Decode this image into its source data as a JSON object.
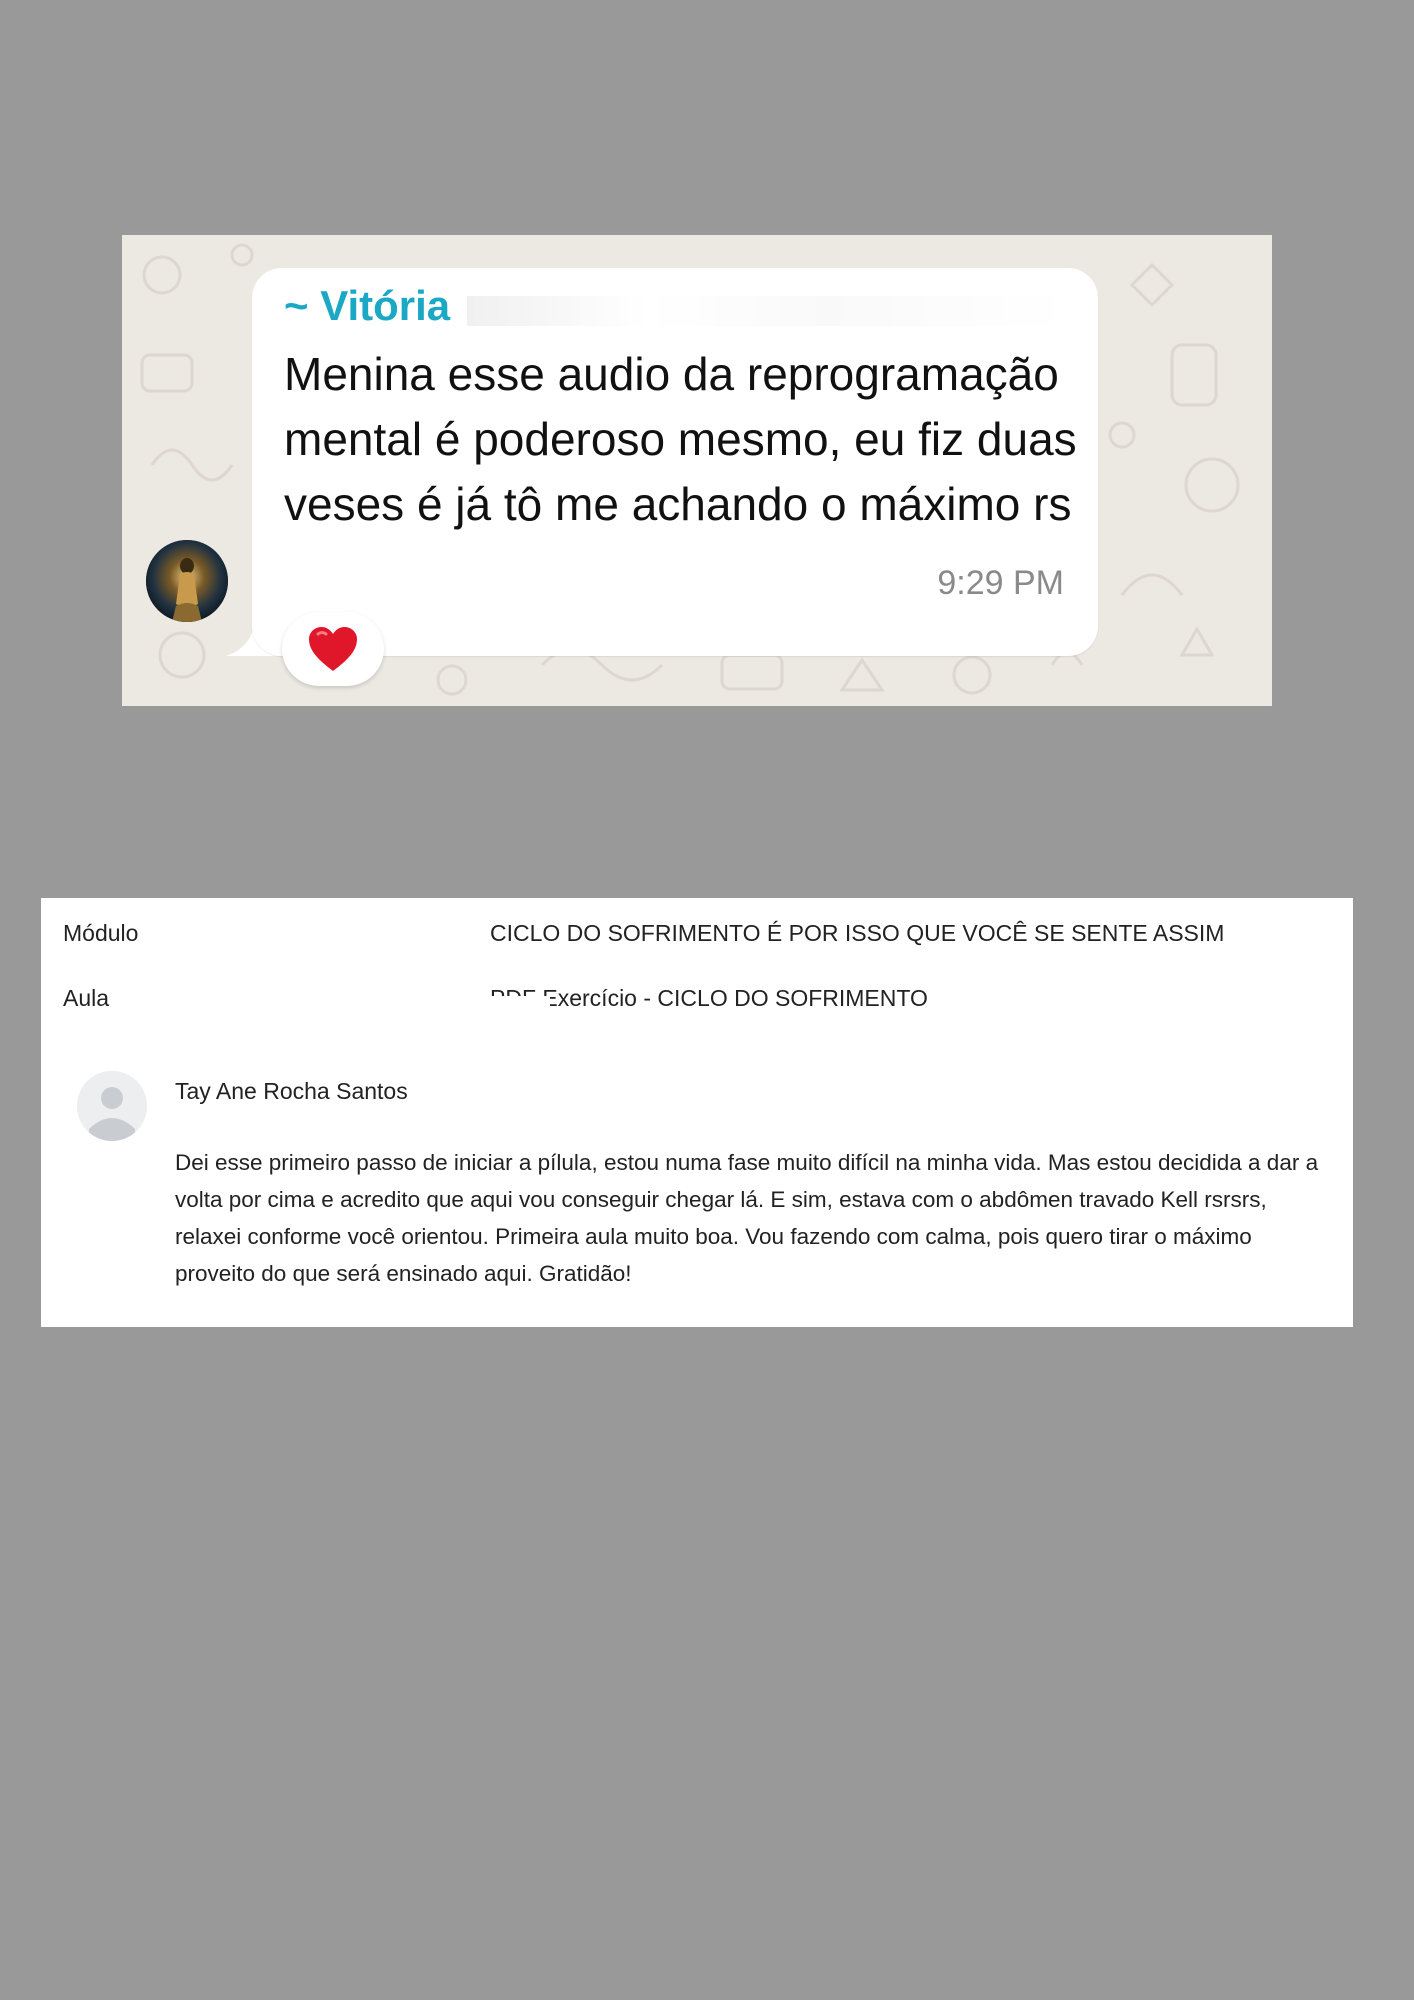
{
  "chat": {
    "sender": "~ Vitória",
    "message": "Menina esse audio da reprogramação mental é poderoso mesmo, eu fiz duas veses é já tô me achando o máximo rs",
    "time": "9:29 PM",
    "reaction_icon": "red-heart-icon",
    "colors": {
      "sender": "#1BA8C4",
      "background": "#ECE8E2",
      "bubble": "#FFFFFF",
      "reaction": "#E0162B"
    }
  },
  "comment": {
    "module_label": "Módulo",
    "module_value": "CICLO DO SOFRIMENTO É POR ISSO QUE VOCÊ SE SENTE ASSIM",
    "lesson_label": "Aula",
    "lesson_value": "PDF Exercício - CICLO DO SOFRIMENTO",
    "author": "Tay Ane Rocha Santos",
    "text": "Dei esse primeiro passo de iniciar a pílula, estou numa fase muito difícil na minha vida. Mas estou decidida a dar a volta por cima e acredito que aqui vou conseguir chegar lá. E sim, estava com o abdômen travado Kell rsrsrs, relaxei conforme você orientou. Primeira aula muito boa. Vou fazendo com calma, pois quero tirar o máximo proveito do que será ensinado aqui. Gratidão!",
    "avatar_icon": "user-placeholder-icon"
  }
}
